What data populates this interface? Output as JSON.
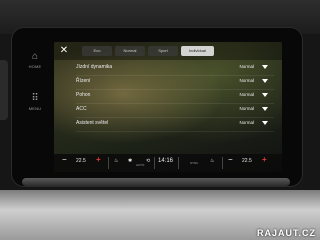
{
  "side_panel": {
    "home_label": "HOME",
    "menu_label": "MENU"
  },
  "tabs": [
    {
      "label": "Eco",
      "active": false
    },
    {
      "label": "Normal",
      "active": false
    },
    {
      "label": "Sport",
      "active": false
    },
    {
      "label": "Individual",
      "active": true
    }
  ],
  "settings": [
    {
      "label": "Jízdní dynamika",
      "value": "Normal"
    },
    {
      "label": "Řízení",
      "value": "Normal"
    },
    {
      "label": "Pohon",
      "value": "Normal"
    },
    {
      "label": "ACC",
      "value": "Normal"
    },
    {
      "label": "Asistent světel",
      "value": "Normal"
    }
  ],
  "status_bar": {
    "left_temp": "22.5",
    "time": "14:16",
    "right_temp": "22.5",
    "auto_label": "AUTO",
    "sync_label": "SYNC"
  },
  "watermark": "RAJAUT.CZ",
  "colors": {
    "plus": "#e23a3a",
    "text": "#ececec"
  }
}
